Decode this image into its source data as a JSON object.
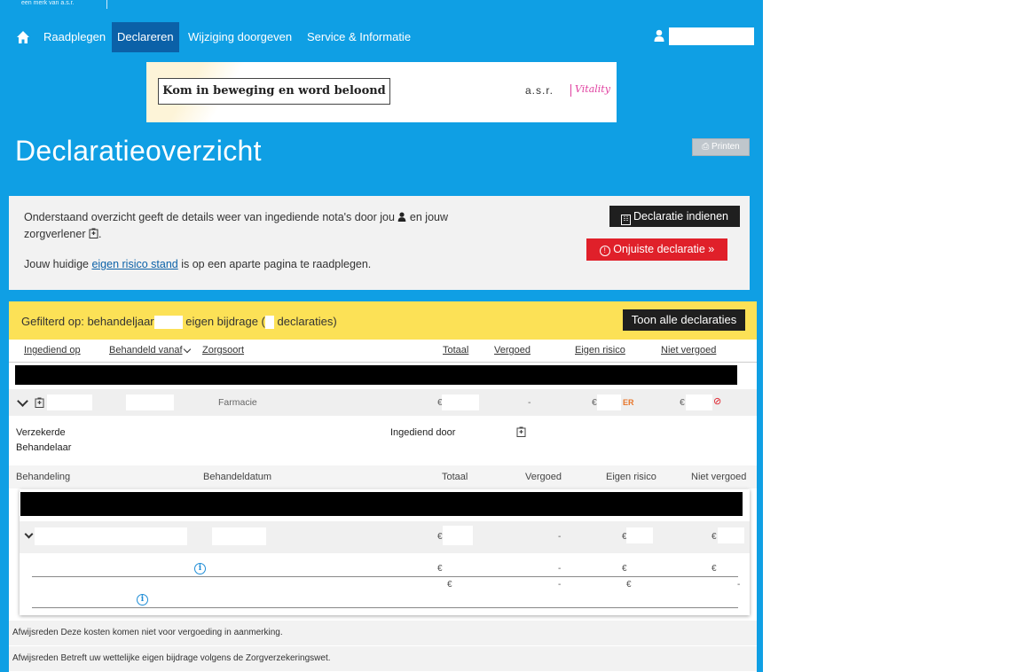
{
  "header": {
    "tagline": "een merk van a.s.r.",
    "nav": [
      "Raadplegen",
      "Declareren",
      "Wijziging doorgeven",
      "Service & Informatie"
    ],
    "active_nav": "Declareren"
  },
  "banner": {
    "text": "Kom in beweging en word beloond",
    "brand": "a.s.r.",
    "brand2": "Vitality"
  },
  "page": {
    "title": "Declaratieoverzicht",
    "print_label": "Printen"
  },
  "info": {
    "line1a": "Onderstaand overzicht geeft de details weer van ingediende nota's door jou",
    "line1b": "en jouw",
    "line2a": "zorgverlener",
    "line2b": ".",
    "line3a": "Jouw huidige",
    "link": "eigen risico stand",
    "line3b": "is op een aparte pagina te raadplegen.",
    "submit_label": "Declaratie indienen",
    "wrong_label": "Onjuiste declaratie"
  },
  "filter": {
    "prefix": "Gefilterd op:",
    "part1": "behandeljaar",
    "part2": "eigen bijdrage (",
    "part3": "declaraties)",
    "showall_label": "Toon alle declaraties"
  },
  "table": {
    "headers": [
      "Ingediend op",
      "Behandeld vanaf",
      "Zorgsoort",
      "Totaal",
      "Vergoed",
      "Eigen risico",
      "Niet vergoed"
    ]
  },
  "claim": {
    "zorgsoort": "Farmacie",
    "currency": "€",
    "vergoed": "-",
    "er_badge": "ER"
  },
  "detail": {
    "verzekerde": "Verzekerde",
    "behandelaar": "Behandelaar",
    "ingediend_door": "Ingediend door"
  },
  "subtable": {
    "headers": [
      "Behandeling",
      "Behandeldatum",
      "Totaal",
      "Vergoed",
      "Eigen risico",
      "Niet vergoed"
    ]
  },
  "inner": {
    "currency": "€",
    "dash": "-"
  },
  "rejections": [
    "Afwijsreden Deze kosten komen niet voor vergoeding in aanmerking.",
    "Afwijsreden Betreft uw wettelijke eigen bijdrage volgens de Zorgverzekeringswet."
  ],
  "colors": {
    "primary": "#0f9fe4",
    "nav_active": "#0b61a8",
    "filter": "#fce156",
    "danger": "#e0202a"
  }
}
